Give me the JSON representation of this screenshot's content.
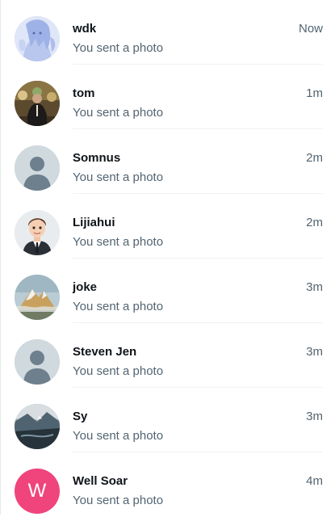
{
  "conversations": [
    {
      "name": "wdk",
      "time": "Now",
      "preview": "You sent a photo",
      "avatar": "anime-art-avatar-icon"
    },
    {
      "name": "tom",
      "time": "1m",
      "preview": "You sent a photo",
      "avatar": "person-photo-avatar-icon"
    },
    {
      "name": "Somnus",
      "time": "2m",
      "preview": "You sent a photo",
      "avatar": "default-user-avatar-icon"
    },
    {
      "name": "Lijiahui",
      "time": "2m",
      "preview": "You sent a photo",
      "avatar": "cartoon-man-avatar-icon"
    },
    {
      "name": "joke",
      "time": "3m",
      "preview": "You sent a photo",
      "avatar": "mountain-photo-avatar-icon"
    },
    {
      "name": "Steven Jen",
      "time": "3m",
      "preview": "You sent a photo",
      "avatar": "default-user-avatar-icon"
    },
    {
      "name": "Sy",
      "time": "3m",
      "preview": "You sent a photo",
      "avatar": "landscape-photo-avatar-icon"
    },
    {
      "name": "Well Soar",
      "time": "4m",
      "preview": "You sent a photo",
      "avatar": "letter-avatar-icon",
      "avatar_letter": "W",
      "avatar_color": "#f0447c"
    }
  ],
  "colors": {
    "name_text": "#0f1419",
    "secondary_text": "#536471",
    "separator": "#eff1f3",
    "default_avatar_bg": "#cfd9de",
    "default_avatar_fg": "#6e7f8d"
  }
}
